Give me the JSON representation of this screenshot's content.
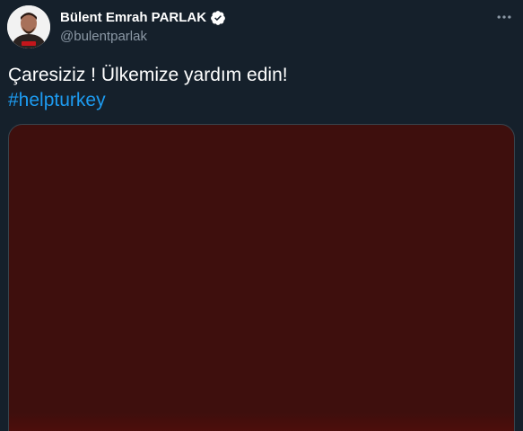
{
  "author": {
    "display_name": "Bülent Emrah PARLAK",
    "handle": "@bulentparlak",
    "verified": true
  },
  "tweet": {
    "text": "Çaresiziz ! Ülkemize yardım edin!",
    "hashtag": "#helpturkey"
  },
  "icons": {
    "verified": "verified-badge-icon",
    "more": "more-options-icon"
  },
  "colors": {
    "background": "#15202b",
    "text_primary": "#ffffff",
    "text_secondary": "#8b98a5",
    "link": "#1d9bf0",
    "media_bg": "#3e0f0d"
  }
}
